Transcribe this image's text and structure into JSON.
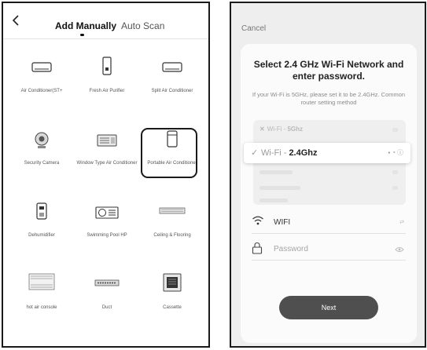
{
  "left_screen": {
    "tabs": [
      {
        "label": "Add Manually",
        "active": true
      },
      {
        "label": "Auto Scan",
        "active": false
      }
    ],
    "devices": [
      {
        "label": "Air Conditioner(ST+",
        "icon": "air-conditioner-icon"
      },
      {
        "label": "Fresh Air Purifier",
        "icon": "air-purifier-icon"
      },
      {
        "label": "Split Air Conditioner",
        "icon": "split-ac-icon"
      },
      {
        "label": "Security Camera",
        "icon": "camera-icon"
      },
      {
        "label": "Window Type Air Conditioner",
        "icon": "window-ac-icon"
      },
      {
        "label": "Portable Air Conditioner",
        "icon": "portable-ac-icon",
        "selected": true
      },
      {
        "label": "Dehumidifier",
        "icon": "dehumidifier-icon"
      },
      {
        "label": "Swimming Pool HP",
        "icon": "pool-heat-pump-icon"
      },
      {
        "label": "Ceiling & Flooring",
        "icon": "ceiling-floor-icon"
      },
      {
        "label": "hot air console",
        "icon": "console-icon"
      },
      {
        "label": "Duct",
        "icon": "duct-icon"
      },
      {
        "label": "Cassette",
        "icon": "cassette-icon"
      }
    ]
  },
  "right_screen": {
    "cancel_label": "Cancel",
    "title": "Select 2.4 GHz Wi-Fi Network and enter password.",
    "note": "If your Wi-Fi is 5GHz, please set it to be 2.4GHz. Common router setting method",
    "networks": {
      "disabled_prefix": "Wi-Fi - ",
      "disabled_band": "5Ghz",
      "selected_prefix": "Wi-Fi - ",
      "selected_band": "2.4Ghz"
    },
    "wifi_field": {
      "value": "WIFI",
      "trailing": "⇄"
    },
    "password_field": {
      "placeholder": "Password"
    },
    "next_label": "Next"
  },
  "colors": {
    "frame": "#1a1a1a",
    "right_background": "#eeeeee",
    "card": "#fbfbfb",
    "button": "#4f4f4f",
    "muted_text": "#8a8a8a"
  }
}
